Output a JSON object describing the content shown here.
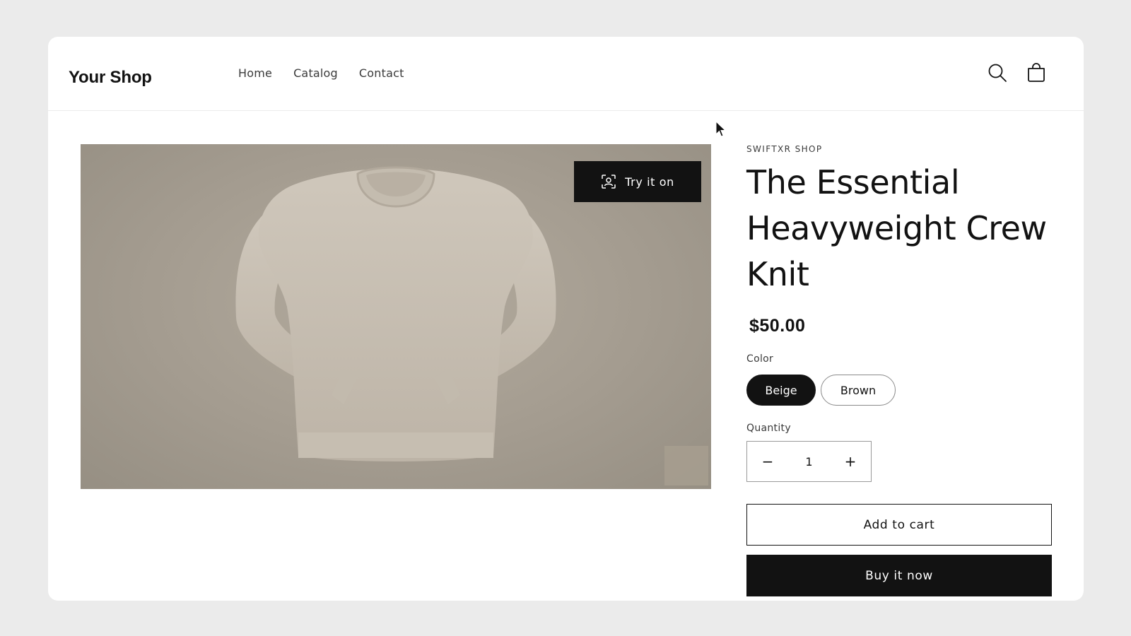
{
  "header": {
    "logo": "Your Shop",
    "nav": [
      {
        "label": "Home"
      },
      {
        "label": "Catalog"
      },
      {
        "label": "Contact"
      }
    ],
    "icons": [
      "search-icon",
      "cart-icon"
    ]
  },
  "media": {
    "try_on_label": "Try it on",
    "try_on_icon": "face-scan-icon",
    "image": "beige-crew-knit-sweater"
  },
  "product": {
    "vendor": "SWIFTXR SHOP",
    "title": "The Essential Heavyweight Crew Knit",
    "price": "$50.00",
    "color_label": "Color",
    "colors": [
      {
        "label": "Beige",
        "selected": true
      },
      {
        "label": "Brown",
        "selected": false
      }
    ],
    "quantity_label": "Quantity",
    "quantity": "1",
    "decrease_symbol": "−",
    "increase_symbol": "+",
    "add_to_cart": "Add to cart",
    "buy_now": "Buy it now"
  },
  "colors": {
    "page_bg": "#ebebeb",
    "card_bg": "#ffffff",
    "primary": "#121212",
    "image_bg": "#a49c90"
  }
}
